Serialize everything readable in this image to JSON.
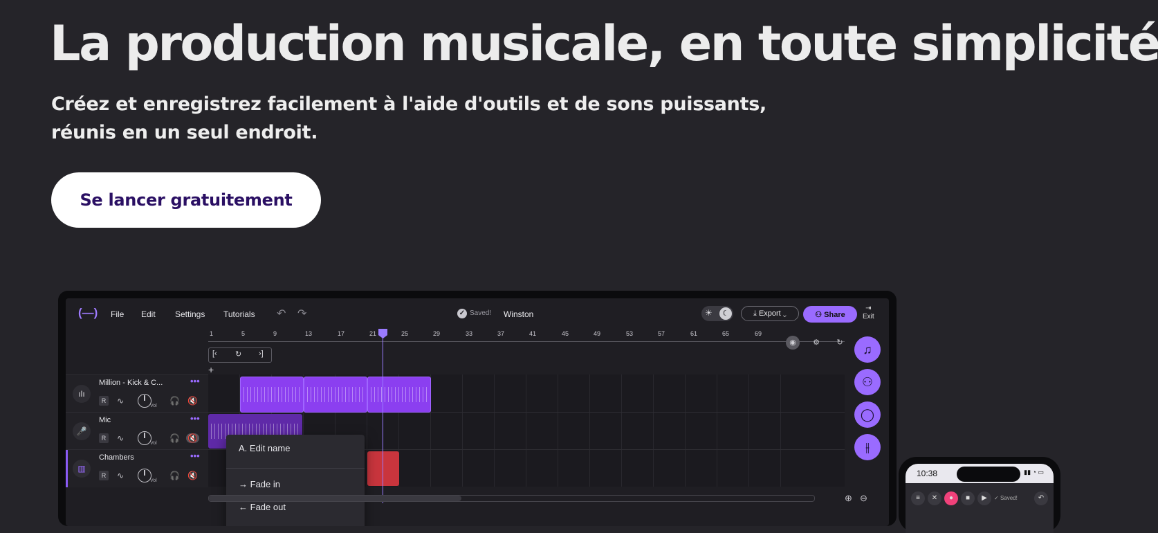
{
  "hero": {
    "title": "La production musicale, en toute simplicité.",
    "subtitle_line1": "Créez et enregistrez facilement à l'aide d'outils et de sons puissants,",
    "subtitle_line2": "réunis en un seul endroit.",
    "cta_label": "Se lancer gratuitement"
  },
  "colors": {
    "background": "#252429",
    "accent": "#9a6bff",
    "cta_text": "#2a0f63",
    "clip_purple": "#8b3ff0",
    "clip_red": "#c9353d"
  },
  "studio": {
    "logo": "(—)",
    "menu": [
      "File",
      "Edit",
      "Settings",
      "Tutorials"
    ],
    "saved_label": "Saved!",
    "project_name": "Winston",
    "export_label": "Export",
    "share_label": "Share",
    "exit_label": "Exit",
    "ruler_ticks": [
      "1",
      "5",
      "9",
      "13",
      "17",
      "21",
      "25",
      "29",
      "33",
      "37",
      "41",
      "45",
      "49",
      "53",
      "57",
      "61",
      "65",
      "69"
    ],
    "tracks": [
      {
        "name": "Million - Kick & C...",
        "icon": "waveform-icon"
      },
      {
        "name": "Mic",
        "icon": "mic-icon"
      },
      {
        "name": "Chambers",
        "icon": "instrument-icon"
      }
    ],
    "record_label": "R",
    "vol_label": "Vol",
    "more_label": "•••",
    "add_track_label": "+",
    "context_menu": {
      "edit_name": "Edit name",
      "fade_in": "Fade in",
      "fade_out": "Fade out"
    },
    "side_icons": [
      "music-note-icon",
      "collab-icon",
      "chat-icon",
      "mixer-icon"
    ]
  },
  "phone": {
    "time": "10:38",
    "saved_label": "Saved!"
  }
}
